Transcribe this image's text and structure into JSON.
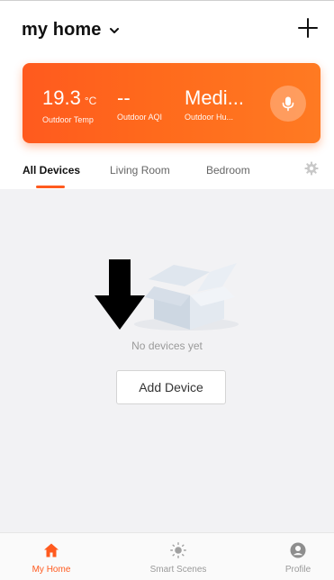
{
  "header": {
    "home_name": "my home",
    "add_icon": "plus-icon",
    "chevron_icon": "chevron-down-icon"
  },
  "weather": {
    "temp_value": "19.3",
    "temp_unit": "°C",
    "temp_label": "Outdoor Temp",
    "aqi_value": "--",
    "aqi_label": "Outdoor AQI",
    "humidity_value": "Medi...",
    "humidity_label": "Outdoor Hu...",
    "mic_icon": "microphone-icon",
    "card_color": "#ff5a1e"
  },
  "tabs": [
    {
      "label": "All Devices",
      "active": true
    },
    {
      "label": "Living Room",
      "active": false
    },
    {
      "label": "Bedroom",
      "active": false
    }
  ],
  "tab_settings_icon": "gear-icon",
  "empty_state": {
    "message": "No devices yet",
    "button_label": "Add Device",
    "illustration": "empty-box-illustration",
    "overlay": "down-arrow"
  },
  "bottom_nav": [
    {
      "label": "My Home",
      "icon": "home-icon",
      "active": true
    },
    {
      "label": "Smart Scenes",
      "icon": "sun-icon",
      "active": false
    },
    {
      "label": "Profile",
      "icon": "user-icon",
      "active": false
    }
  ],
  "colors": {
    "accent": "#ff5a1e",
    "background": "#f2f2f4",
    "inactive_text": "#9a9a9a"
  }
}
